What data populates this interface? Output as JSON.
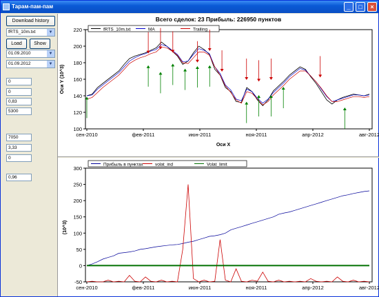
{
  "window": {
    "title": "Тарам-пам-пам"
  },
  "left_panel": {
    "download_button": "Download history",
    "file_select": "fRTS_10m.txt",
    "load_button": "Load",
    "show_button": "Show",
    "date_from": "01.09.2010",
    "date_to": "01.09.2012",
    "fields": [
      "0",
      "0",
      "0,83",
      "5300",
      "7050",
      "3,33",
      "0",
      "0,96"
    ]
  },
  "chart_data": [
    {
      "type": "line",
      "title": "Всего сделок:  23 Прибыль: 226950 пунктов",
      "xlabel": "Оси X",
      "ylabel": "Оси Y (10^3)",
      "legend_placement": "top-left",
      "ylim": [
        100,
        220
      ],
      "yticks": [
        "100",
        "120",
        "140",
        "160",
        "180",
        "200",
        "220"
      ],
      "xticks": [
        "сен-2010",
        "фев-2011",
        "июн-2011",
        "ноя-2011",
        "апр-2012",
        "авг-2012"
      ],
      "series": [
        {
          "name": "fRTS_10m.txt",
          "color": "#000000",
          "values": [
            140,
            142,
            150,
            155,
            160,
            165,
            170,
            178,
            185,
            188,
            190,
            192,
            195,
            198,
            205,
            200,
            194,
            188,
            178,
            182,
            192,
            200,
            196,
            190,
            172,
            165,
            150,
            145,
            133,
            132,
            150,
            145,
            135,
            128,
            135,
            146,
            152,
            158,
            165,
            170,
            175,
            172,
            163,
            155,
            145,
            135,
            130,
            135,
            138,
            140,
            142,
            141,
            140,
            142
          ]
        },
        {
          "name": "MA",
          "color": "#0000cc",
          "values": [
            140,
            141,
            148,
            153,
            158,
            163,
            168,
            175,
            182,
            186,
            189,
            191,
            194,
            196,
            202,
            200,
            195,
            190,
            181,
            182,
            190,
            197,
            195,
            191,
            175,
            167,
            153,
            147,
            136,
            134,
            148,
            145,
            137,
            131,
            136,
            144,
            150,
            156,
            163,
            168,
            173,
            171,
            164,
            157,
            148,
            139,
            133,
            135,
            137,
            139,
            141,
            141,
            140,
            141
          ]
        },
        {
          "name": "Trailing",
          "color": "#cc0000",
          "values": [
            136,
            138,
            144,
            150,
            155,
            160,
            165,
            172,
            179,
            183,
            186,
            188,
            191,
            193,
            199,
            198,
            194,
            189,
            180,
            179,
            186,
            193,
            193,
            189,
            175,
            165,
            152,
            144,
            135,
            131,
            145,
            143,
            136,
            129,
            133,
            141,
            147,
            153,
            160,
            165,
            170,
            170,
            164,
            157,
            149,
            140,
            133,
            133,
            135,
            137,
            139,
            139,
            138,
            139
          ]
        }
      ],
      "signals": {
        "buy": [
          [
            "сен-2010",
            138
          ],
          [
            "фев-2011",
            176
          ],
          [
            "мар-2011",
            168
          ],
          [
            "апр-2011",
            178
          ],
          [
            "май-2011",
            172
          ],
          [
            "июн-2011",
            175
          ],
          [
            "июл-2011",
            176
          ],
          [
            "окт-2011",
            132
          ],
          [
            "ноя-2011",
            140
          ],
          [
            "дек-2011",
            140
          ],
          [
            "янв-2012",
            150
          ],
          [
            "июн-2012",
            125
          ]
        ],
        "sell": [
          [
            "фев-2011",
            192
          ],
          [
            "мар-2011",
            197
          ],
          [
            "апр-2011",
            193
          ],
          [
            "июн-2011",
            181
          ],
          [
            "июл-2011",
            195
          ],
          [
            "авг-2011",
            170
          ],
          [
            "окт-2011",
            160
          ],
          [
            "ноя-2011",
            158
          ],
          [
            "дек-2011",
            160
          ],
          [
            "апр-2012",
            163
          ]
        ]
      }
    },
    {
      "type": "line",
      "title": "",
      "xlabel": "",
      "ylabel": "(10^3)",
      "legend_placement": "top-left",
      "ylim": [
        -50,
        300
      ],
      "yticks": [
        "-50",
        "0",
        "50",
        "100",
        "150",
        "200",
        "250",
        "300"
      ],
      "xticks": [
        "сен-2010",
        "фев-2011",
        "июн-2011",
        "ноя-2011",
        "апр-2012",
        "авг-2012"
      ],
      "series": [
        {
          "name": "Прибыль в пунктах",
          "color": "#000099",
          "values": [
            0,
            5,
            12,
            20,
            25,
            30,
            38,
            40,
            42,
            45,
            50,
            52,
            55,
            58,
            60,
            62,
            64,
            65,
            68,
            72,
            75,
            80,
            85,
            90,
            92,
            95,
            100,
            110,
            115,
            120,
            125,
            130,
            135,
            140,
            145,
            150,
            158,
            162,
            165,
            170,
            175,
            180,
            185,
            190,
            195,
            200,
            205,
            210,
            215,
            218,
            222,
            225,
            228,
            230
          ]
        },
        {
          "name": "volat_ind",
          "color": "#cc0000",
          "values": [
            -50,
            -48,
            -50,
            -50,
            -45,
            -50,
            -48,
            -50,
            -30,
            -48,
            -50,
            -35,
            -48,
            -50,
            -45,
            -50,
            -48,
            -50,
            50,
            250,
            -40,
            -50,
            -45,
            -50,
            -48,
            80,
            -45,
            -50,
            -10,
            -48,
            -50,
            -45,
            -48,
            -20,
            -48,
            -50,
            -45,
            -50,
            -48,
            -50,
            -48,
            -50,
            -40,
            -48,
            -50,
            -48,
            -50,
            -35,
            -48,
            -50,
            -45,
            -50,
            -48,
            -50
          ]
        },
        {
          "name": "Volat_limit",
          "color": "#007000",
          "values": [
            0,
            0,
            0,
            0,
            0,
            0,
            0,
            0,
            0,
            0,
            0,
            0,
            0,
            0,
            0,
            0,
            0,
            0,
            0,
            0,
            0,
            0,
            0,
            0,
            0,
            0,
            0,
            0,
            0,
            0,
            0,
            0,
            0,
            0,
            0,
            0,
            0,
            0,
            0,
            0,
            0,
            0,
            0,
            0,
            0,
            0,
            0,
            0,
            0,
            0,
            0,
            0,
            0,
            0
          ]
        }
      ]
    }
  ]
}
